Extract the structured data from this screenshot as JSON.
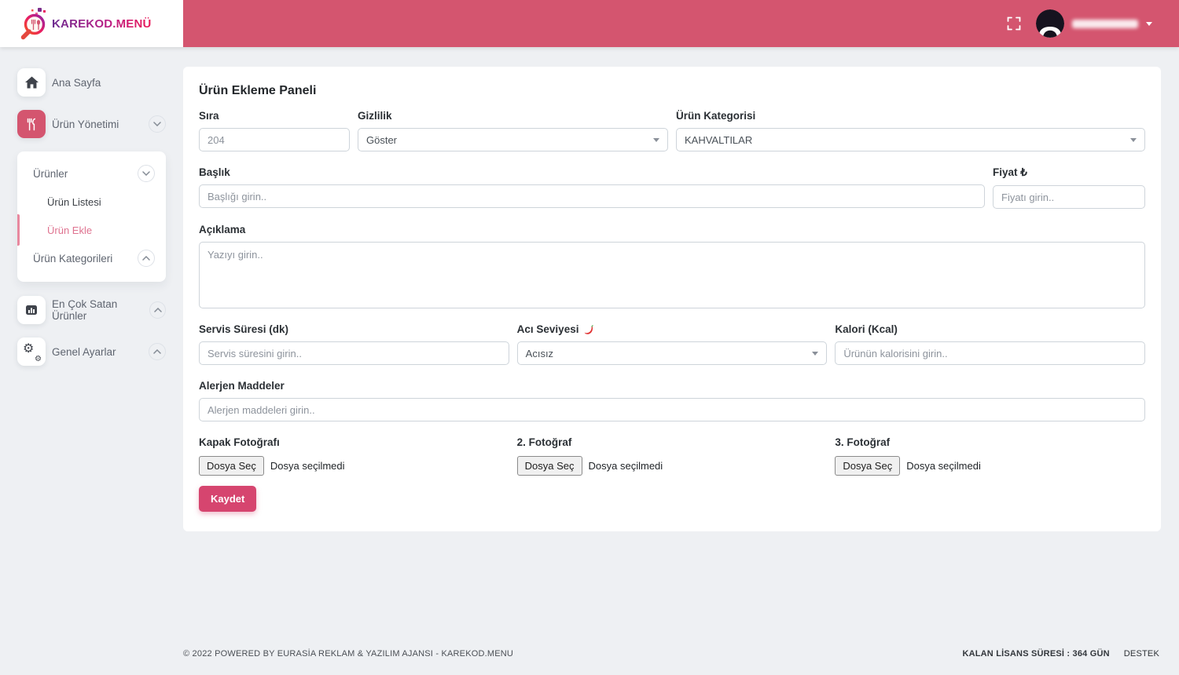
{
  "header": {
    "brand": "KAREKOD.MENÜ"
  },
  "icons": {
    "logo": "magnifier-qr-cutlery",
    "fullscreen": "expand-corners",
    "avatar": "person-silhouette",
    "user_caret": "caret-down",
    "home": "house",
    "product_management": "utensils",
    "best_sellers": "bar-chart",
    "settings": "gears",
    "chevron": "chevron-in-circle",
    "spice": "chili-pepper",
    "select_caret": "caret-down"
  },
  "colors": {
    "brand_pink": "#d4556f",
    "active_link_pink": "#df7390",
    "save_button_pink": "#d6456f",
    "page_background": "#eef0f3"
  },
  "sidebar": {
    "home": "Ana Sayfa",
    "product_management": "Ürün Yönetimi",
    "submenu": {
      "products": "Ürünler",
      "product_list": "Ürün Listesi",
      "product_add": "Ürün Ekle",
      "product_categories": "Ürün Kategorileri"
    },
    "best_sellers": "En Çok Satan Ürünler",
    "settings": "Genel Ayarlar"
  },
  "form": {
    "title": "Ürün Ekleme Paneli",
    "sira": {
      "label": "Sıra",
      "value": "204"
    },
    "gizlilik": {
      "label": "Gizlilik",
      "value": "Göster"
    },
    "kategori": {
      "label": "Ürün Kategorisi",
      "value": "KAHVALTILAR"
    },
    "baslik": {
      "label": "Başlık",
      "placeholder": "Başlığı girin.."
    },
    "fiyat": {
      "label": "Fiyat ₺",
      "placeholder": "Fiyatı girin.."
    },
    "aciklama": {
      "label": "Açıklama",
      "placeholder": "Yazıyı girin.."
    },
    "servis": {
      "label": "Servis Süresi (dk)",
      "placeholder": "Servis süresini girin.."
    },
    "aci": {
      "label": "Acı Seviyesi",
      "value": "Acısız"
    },
    "kalori": {
      "label": "Kalori (Kcal)",
      "placeholder": "Ürünün kalorisini girin.."
    },
    "alerjen": {
      "label": "Alerjen Maddeler",
      "placeholder": "Alerjen maddeleri girin.."
    },
    "photos": {
      "cover_label": "Kapak Fotoğrafı",
      "second_label": "2. Fotoğraf",
      "third_label": "3. Fotoğraf",
      "file_button": "Dosya Seç",
      "no_file": "Dosya seçilmedi"
    },
    "save_label": "Kaydet"
  },
  "footer": {
    "copyright": "© 2022 POWERED BY EURASİA REKLAM & YAZILIM AJANSI - KAREKOD.MENU",
    "license": "KALAN LİSANS SÜRESİ : 364 GÜN",
    "support": "DESTEK"
  }
}
